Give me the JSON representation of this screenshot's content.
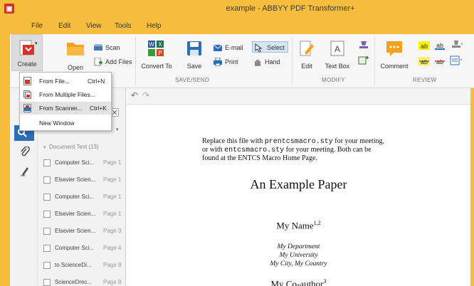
{
  "window": {
    "title": "example - ABBYY PDF Transformer+"
  },
  "menu": [
    "File",
    "Edit",
    "View",
    "Tools",
    "Help"
  ],
  "ribbon": {
    "create": "Create",
    "open": "Open",
    "scan": "Scan",
    "add_files": "Add Files",
    "convert_to": "Convert To",
    "save": "Save",
    "email": "E-mail",
    "print": "Print",
    "select": "Select",
    "hand": "Hand",
    "edit": "Edit",
    "text_box": "Text Box",
    "comment": "Comment",
    "groups": {
      "save_send": "SAVE/SEND",
      "modify": "MODIFY",
      "review": "REVIEW"
    }
  },
  "dropdown": [
    {
      "label": "From File...",
      "shortcut": "Ctrl+N"
    },
    {
      "label": "From Multiple Files...",
      "shortcut": ""
    },
    {
      "label": "From Scanner...",
      "shortcut": "Ctrl+K"
    },
    {
      "label": "New Window",
      "shortcut": ""
    }
  ],
  "panel": {
    "header": "Document Text (13)",
    "rows": [
      {
        "title": "Computer Sci...",
        "page": "Page 1"
      },
      {
        "title": "Elsevier Scien...",
        "page": "Page 1"
      },
      {
        "title": "Computer Sci...",
        "page": "Page 1"
      },
      {
        "title": "Elsevier Scien...",
        "page": "Page 1"
      },
      {
        "title": "Elsevier Scien...",
        "page": "Page 3"
      },
      {
        "title": "Computer Sci...",
        "page": "Page 4"
      },
      {
        "title": "to ScienceDi...",
        "page": "Page 8"
      },
      {
        "title": "ScienceDrec...",
        "page": "Page 8"
      }
    ]
  },
  "document": {
    "intro_1a": "Replace this file with ",
    "intro_1b": "prentcsmacro.sty",
    "intro_1c": " for your meeting,",
    "intro_2a": "or with ",
    "intro_2b": "entcsmacro.sty",
    "intro_2c": " for your meeting. Both can be",
    "intro_3": "found at the ENTCS Macro Home Page.",
    "title": "An Example Paper",
    "author1": "My Name",
    "author1_sup": "1,2",
    "dept": "My Department",
    "univ": "My University",
    "city": "My City, My Country",
    "author2": "My Co-author",
    "author2_sup": "3"
  }
}
